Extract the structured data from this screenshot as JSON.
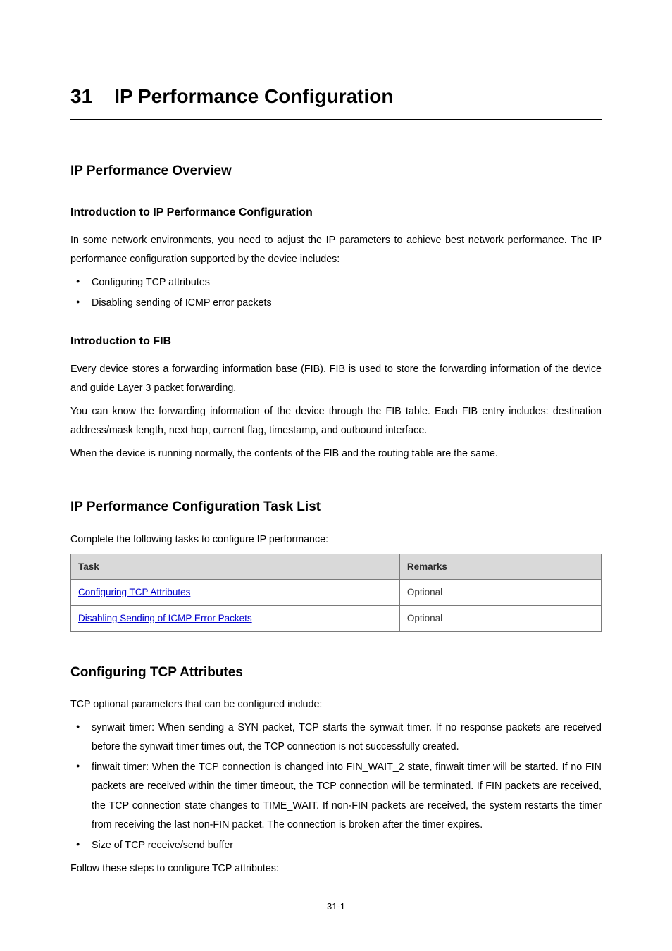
{
  "chapter": {
    "number": "31",
    "title": "IP Performance Configuration"
  },
  "overview": {
    "heading": "IP Performance Overview",
    "intro_sub": "Introduction to IP Performance Configuration",
    "intro_para": "In some network environments, you need to adjust the IP parameters to achieve best network performance. The IP performance configuration supported by the device includes:",
    "intro_bullets": [
      "Configuring TCP attributes",
      "Disabling sending of ICMP error packets"
    ],
    "fib_sub": "Introduction to FIB",
    "fib_p1": "Every device stores a forwarding information base (FIB). FIB is used to store the forwarding information of the device and guide Layer 3 packet forwarding.",
    "fib_p2": "You can know the forwarding information of the device through the FIB table. Each FIB entry includes: destination address/mask length, next hop, current flag, timestamp, and outbound interface.",
    "fib_p3": "When the device is running normally, the contents of the FIB and the routing table are the same."
  },
  "tasklist": {
    "heading": "IP Performance Configuration Task List",
    "lead": "Complete the following tasks to configure IP performance:",
    "headers": {
      "task": "Task",
      "remarks": "Remarks"
    },
    "rows": [
      {
        "task": "Configuring TCP Attributes",
        "remarks": "Optional"
      },
      {
        "task": "Disabling Sending of ICMP Error Packets",
        "remarks": "Optional"
      }
    ]
  },
  "tcp": {
    "heading": "Configuring TCP Attributes",
    "lead": "TCP optional parameters that can be configured include:",
    "bullets": [
      "synwait timer: When sending a SYN packet, TCP starts the synwait timer. If no response packets are received before the synwait timer times out, the TCP connection is not successfully created.",
      "finwait timer: When the TCP connection is changed into FIN_WAIT_2 state, finwait timer will be started. If no FIN packets are received within the timer timeout, the TCP connection will be terminated. If FIN packets are received, the TCP connection state changes to TIME_WAIT. If non-FIN packets are received, the system restarts the timer from receiving the last non-FIN packet. The connection is broken after the timer expires.",
      "Size of TCP receive/send buffer"
    ],
    "follow": "Follow these steps to configure TCP attributes:"
  },
  "page_number": "31-1"
}
